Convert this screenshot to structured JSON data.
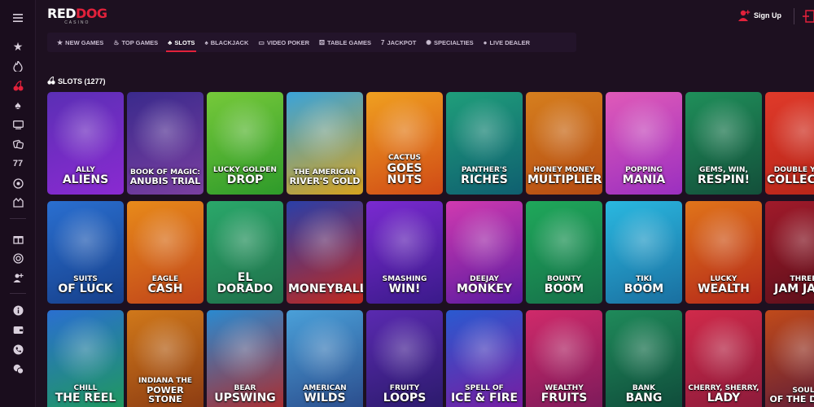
{
  "header": {
    "brand_red": "RED",
    "brand_dog": "DOG",
    "brand_sub": "CASINO",
    "signup_label": "Sign Up"
  },
  "nav": [
    {
      "label": "NEW GAMES",
      "icon": "star-icon",
      "glyph": "★"
    },
    {
      "label": "TOP GAMES",
      "icon": "flame-icon",
      "glyph": "♨"
    },
    {
      "label": "SLOTS",
      "icon": "cherry-icon",
      "glyph": "♣"
    },
    {
      "label": "BLACKJACK",
      "icon": "spade-icon",
      "glyph": "♠"
    },
    {
      "label": "VIDEO POKER",
      "icon": "monitor-icon",
      "glyph": "▭"
    },
    {
      "label": "TABLE GAMES",
      "icon": "dice-icon",
      "glyph": "⚄"
    },
    {
      "label": "JACKPOT",
      "icon": "seven-icon",
      "glyph": "7"
    },
    {
      "label": "SPECIALTIES",
      "icon": "wheel-icon",
      "glyph": "✺"
    },
    {
      "label": "LIVE DEALER",
      "icon": "dealer-icon",
      "glyph": "●"
    }
  ],
  "active_nav": "SLOTS",
  "section": {
    "title": "SLOTS (1277)"
  },
  "colors": {
    "accent": "#e2213b",
    "bg": "#1d1020"
  },
  "games": [
    [
      {
        "l1": "ALLY",
        "l2": "ALIENS",
        "c1": "#5b2fb5",
        "c2": "#8a2ad1"
      },
      {
        "l1": "BOOK OF MAGIC:",
        "l2": "ANUBIS TRIAL",
        "c1": "#3a2a8c",
        "c2": "#7a3fa0"
      },
      {
        "l1": "LUCKY GOLDEN",
        "l2": "DROP",
        "c1": "#76c93a",
        "c2": "#2e9a2a"
      },
      {
        "l1": "THE AMERICAN",
        "l2": "RIVER'S GOLD",
        "c1": "#3aa3d9",
        "c2": "#d6a21e"
      },
      {
        "l1": "CACTUS",
        "l2": "GOES NUTS",
        "c1": "#f0a020",
        "c2": "#d04a16"
      },
      {
        "l1": "PANTHER'S",
        "l2": "RICHES",
        "c1": "#1f9e7a",
        "c2": "#0f5f70"
      },
      {
        "l1": "HONEY MONEY",
        "l2": "MULTIPLIER",
        "c1": "#d67f1e",
        "c2": "#b44a12"
      },
      {
        "l1": "POPPING",
        "l2": "MANIA",
        "c1": "#e05ab8",
        "c2": "#9b2fc0"
      },
      {
        "l1": "GEMS, WIN,",
        "l2": "RESPIN!",
        "c1": "#1f8f5a",
        "c2": "#134f3a"
      },
      {
        "l1": "DOUBLE YOUR",
        "l2": "COLLECTION",
        "c1": "#e03a2a",
        "c2": "#b52418"
      }
    ],
    [
      {
        "l1": "SUITS",
        "l2": "OF LUCK",
        "c1": "#2a6fd0",
        "c2": "#163f8a"
      },
      {
        "l1": "EAGLE",
        "l2": "CASH",
        "c1": "#e88a1a",
        "c2": "#c0441a"
      },
      {
        "l1": "",
        "l2": "EL DORADO",
        "c1": "#2aa86a",
        "c2": "#1f6f4a"
      },
      {
        "l1": "",
        "l2": "MONEYBALL",
        "c1": "#2a3fa8",
        "c2": "#c0281e"
      },
      {
        "l1": "SMASHING",
        "l2": "WIN!",
        "c1": "#7a2ad0",
        "c2": "#3a1a8a"
      },
      {
        "l1": "DEEJAY",
        "l2": "MONKEY",
        "c1": "#d03ab0",
        "c2": "#5a1aa0"
      },
      {
        "l1": "BOUNTY",
        "l2": "BOOM",
        "c1": "#1fa85a",
        "c2": "#16704a"
      },
      {
        "l1": "TIKI",
        "l2": "BOOM",
        "c1": "#2ab8e0",
        "c2": "#1a6fa0"
      },
      {
        "l1": "LUCKY",
        "l2": "WEALTH",
        "c1": "#e0741a",
        "c2": "#b4281a"
      },
      {
        "l1": "THREE",
        "l2": "JAM JARS",
        "c1": "#a01a2a",
        "c2": "#5a0f1a"
      }
    ],
    [
      {
        "l1": "CHILL",
        "l2": "THE REEL",
        "c1": "#2a6fd0",
        "c2": "#1f9a5a"
      },
      {
        "l1": "INDIANA THE",
        "l2": "POWER STONE",
        "c1": "#d0781a",
        "c2": "#8a3a12"
      },
      {
        "l1": "BEAR",
        "l2": "UPSWING",
        "c1": "#2a8ad0",
        "c2": "#b02a2a"
      },
      {
        "l1": "AMERICAN",
        "l2": "WILDS",
        "c1": "#4aa0d9",
        "c2": "#2a4a8a"
      },
      {
        "l1": "FRUITY",
        "l2": "LOOPS",
        "c1": "#5a2ab0",
        "c2": "#2a1a6a"
      },
      {
        "l1": "SPELL OF",
        "l2": "ICE & FIRE",
        "c1": "#2a5ad0",
        "c2": "#7a1aa0"
      },
      {
        "l1": "WEALTHY",
        "l2": "FRUITS",
        "c1": "#d02a6a",
        "c2": "#7a1a5a"
      },
      {
        "l1": "BANK",
        "l2": "BANG",
        "c1": "#1f8a5a",
        "c2": "#0f4a3a"
      },
      {
        "l1": "CHERRY, SHERRY,",
        "l2": "LADY",
        "c1": "#d02a4a",
        "c2": "#8a1a3a"
      },
      {
        "l1": "SOUL",
        "l2": "OF THE DEAD",
        "c1": "#c04a1a",
        "c2": "#5a1a3a"
      }
    ]
  ]
}
